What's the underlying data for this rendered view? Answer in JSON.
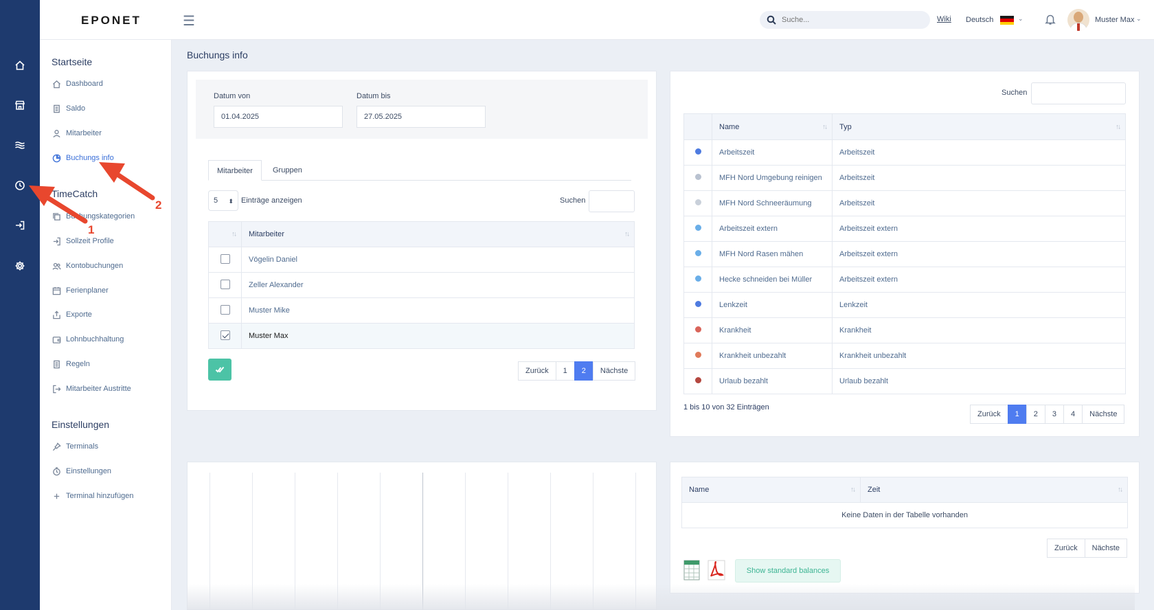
{
  "header": {
    "logo": "EPONET",
    "search_placeholder": "Suche...",
    "wiki": "Wiki",
    "language": "Deutsch",
    "user_name": "Muster Max"
  },
  "menu": {
    "section_start": "Startseite",
    "start_items": [
      "Dashboard",
      "Saldo",
      "Mitarbeiter",
      "Buchungs info"
    ],
    "section_timecatch": "TimeCatch",
    "timecatch_items": [
      "Buchungskategorien",
      "Sollzeit Profile",
      "Kontobuchungen",
      "Ferienplaner",
      "Exporte",
      "Lohnbuchhaltung",
      "Regeln",
      "Mitarbeiter Austritte"
    ],
    "section_settings": "Einstellungen",
    "settings_items": [
      "Terminals",
      "Einstellungen",
      "Terminal hinzufügen"
    ]
  },
  "page": {
    "title": "Buchungs info"
  },
  "filter": {
    "from_label": "Datum von",
    "from_value": "01.04.2025",
    "to_label": "Datum bis",
    "to_value": "27.05.2025"
  },
  "employees": {
    "tabs": [
      "Mitarbeiter",
      "Gruppen"
    ],
    "length_value": "5",
    "length_label": "Einträge anzeigen",
    "search_label": "Suchen",
    "column": "Mitarbeiter",
    "rows": [
      {
        "name": "Vögelin Daniel",
        "checked": false
      },
      {
        "name": "Zeller Alexander",
        "checked": false
      },
      {
        "name": "Muster Mike",
        "checked": false
      },
      {
        "name": "Muster Max",
        "checked": true
      }
    ],
    "pager": [
      "Zurück",
      "1",
      "2",
      "Nächste"
    ],
    "pager_active": "2"
  },
  "categories": {
    "search_label": "Suchen",
    "columns": [
      "Name",
      "Typ"
    ],
    "rows": [
      {
        "name": "Arbeitszeit",
        "type": "Arbeitszeit",
        "color": "#4e7be0"
      },
      {
        "name": "MFH Nord Umgebung reinigen",
        "type": "Arbeitszeit",
        "color": "#b9c2d0"
      },
      {
        "name": "MFH Nord Schneeräumung",
        "type": "Arbeitszeit",
        "color": "#c9d0da"
      },
      {
        "name": "Arbeitszeit extern",
        "type": "Arbeitszeit extern",
        "color": "#6aaee8"
      },
      {
        "name": "MFH Nord Rasen mähen",
        "type": "Arbeitszeit extern",
        "color": "#6aaee8"
      },
      {
        "name": "Hecke schneiden bei Müller",
        "type": "Arbeitszeit extern",
        "color": "#6aaee8"
      },
      {
        "name": "Lenkzeit",
        "type": "Lenkzeit",
        "color": "#4e7be0"
      },
      {
        "name": "Krankheit",
        "type": "Krankheit",
        "color": "#d9645a"
      },
      {
        "name": "Krankheit unbezahlt",
        "type": "Krankheit unbezahlt",
        "color": "#e07a5a"
      },
      {
        "name": "Urlaub bezahlt",
        "type": "Urlaub bezahlt",
        "color": "#b4473f"
      }
    ],
    "info": "1 bis 10 von 32 Einträgen",
    "pager": [
      "Zurück",
      "1",
      "2",
      "3",
      "4",
      "Nächste"
    ],
    "pager_active": "1"
  },
  "balances": {
    "columns": [
      "Name",
      "Zeit"
    ],
    "empty_text": "Keine Daten in der Tabelle vorhanden",
    "pager": [
      "Zurück",
      "Nächste"
    ],
    "show_button": "Show standard balances"
  },
  "annotations": [
    "1",
    "2"
  ],
  "colors": {
    "rail": "#1e3a6e",
    "accent": "#4f7cf0",
    "annotation": "#e8472e",
    "confirm": "#4cc3a6"
  }
}
